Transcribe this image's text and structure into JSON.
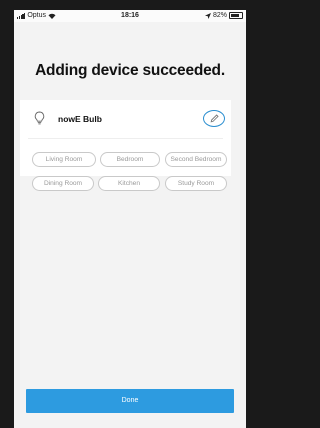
{
  "status_bar": {
    "carrier": "Optus",
    "time": "18:16",
    "battery": "82%"
  },
  "title": "Adding device succeeded.",
  "device": {
    "name": "nowE Bulb",
    "icon": "bulb-icon",
    "edit_icon": "pencil-icon"
  },
  "rooms": [
    "Living Room",
    "Bedroom",
    "Second Bedroom",
    "Dining Room",
    "Kitchen",
    "Study Room"
  ],
  "done_label": "Done",
  "colors": {
    "accent": "#2d9be0",
    "edit_ring": "#2c8fd0",
    "background": "#f3f3f3"
  }
}
